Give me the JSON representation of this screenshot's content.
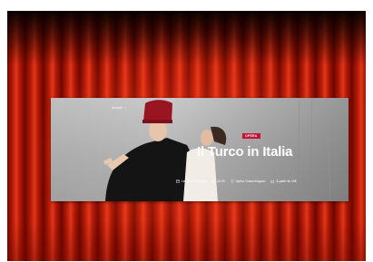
{
  "breadcrumb": {
    "home": "Accueil",
    "separator": "›"
  },
  "tag": "OPÉRA",
  "title": "Il Turco in Italia",
  "meta": {
    "date": "Les 22 et 24 mars",
    "time": "20:00",
    "venue": "Opéra Grand Avignon",
    "price": "À partir de 15€"
  },
  "colors": {
    "tag_bg": "#c5143a",
    "curtain": "#c0200a"
  }
}
